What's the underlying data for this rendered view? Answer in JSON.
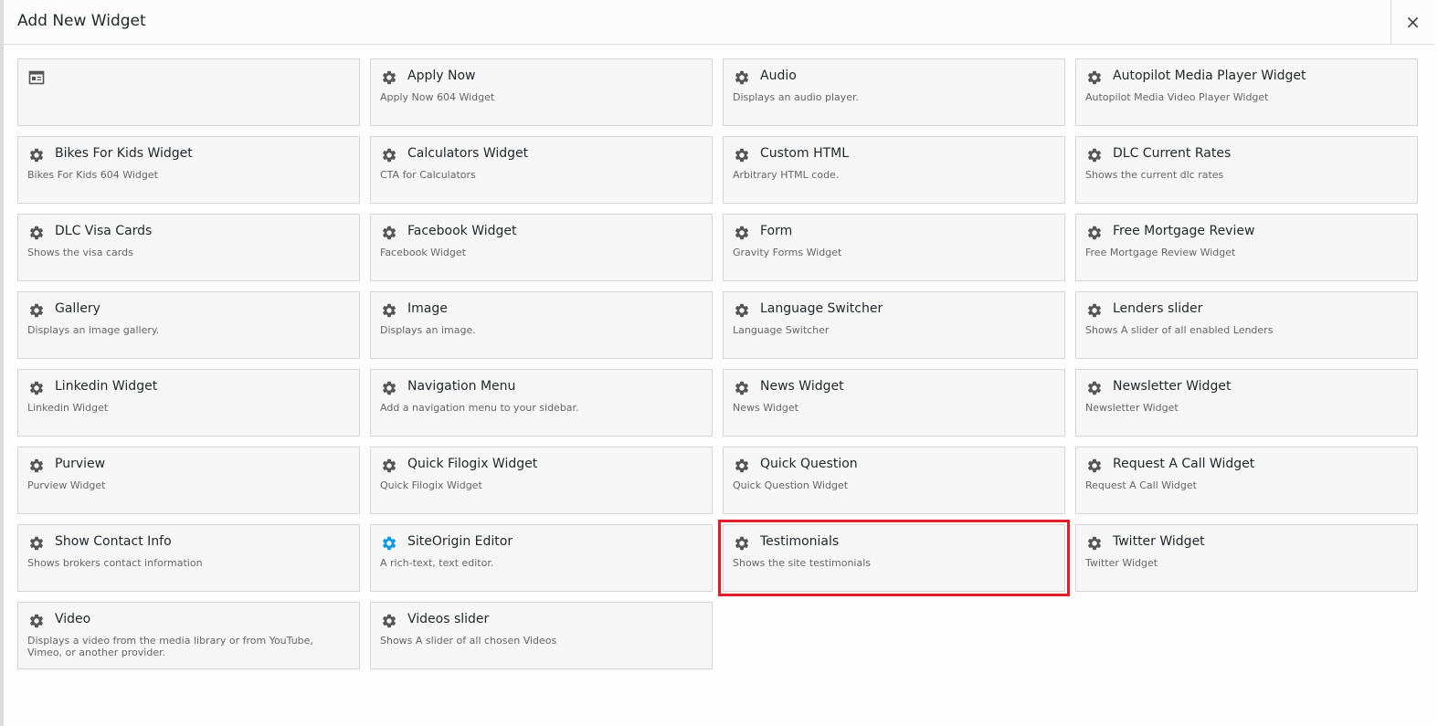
{
  "dialog": {
    "title": "Add New Widget",
    "close_label": "×"
  },
  "colors": {
    "icon_default": "#555555",
    "icon_active": "#0a9be8",
    "highlight_outline": "#e01d2b"
  },
  "widgets": [
    {
      "title": "",
      "desc": "",
      "icon": "siteorigin-widget-icon"
    },
    {
      "title": "Apply Now",
      "desc": "Apply Now 604 Widget",
      "icon": "gear-icon"
    },
    {
      "title": "Audio",
      "desc": "Displays an audio player.",
      "icon": "gear-icon"
    },
    {
      "title": "Autopilot Media Player Widget",
      "desc": "Autopilot Media Video Player Widget",
      "icon": "gear-icon"
    },
    {
      "title": "Bikes For Kids Widget",
      "desc": "Bikes For Kids 604 Widget",
      "icon": "gear-icon"
    },
    {
      "title": "Calculators Widget",
      "desc": "CTA for Calculators",
      "icon": "gear-icon"
    },
    {
      "title": "Custom HTML",
      "desc": "Arbitrary HTML code.",
      "icon": "gear-icon"
    },
    {
      "title": "DLC Current Rates",
      "desc": "Shows the current dlc rates",
      "icon": "gear-icon"
    },
    {
      "title": "DLC Visa Cards",
      "desc": "Shows the visa cards",
      "icon": "gear-icon"
    },
    {
      "title": "Facebook Widget",
      "desc": "Facebook Widget",
      "icon": "gear-icon"
    },
    {
      "title": "Form",
      "desc": "Gravity Forms Widget",
      "icon": "gear-icon"
    },
    {
      "title": "Free Mortgage Review",
      "desc": "Free Mortgage Review Widget",
      "icon": "gear-icon"
    },
    {
      "title": "Gallery",
      "desc": "Displays an image gallery.",
      "icon": "gear-icon"
    },
    {
      "title": "Image",
      "desc": "Displays an image.",
      "icon": "gear-icon"
    },
    {
      "title": "Language Switcher",
      "desc": "Language Switcher",
      "icon": "gear-icon"
    },
    {
      "title": "Lenders slider",
      "desc": "Shows A slider of all enabled Lenders",
      "icon": "gear-icon"
    },
    {
      "title": "Linkedin Widget",
      "desc": "Linkedin Widget",
      "icon": "gear-icon"
    },
    {
      "title": "Navigation Menu",
      "desc": "Add a navigation menu to your sidebar.",
      "icon": "gear-icon"
    },
    {
      "title": "News Widget",
      "desc": "News Widget",
      "icon": "gear-icon"
    },
    {
      "title": "Newsletter Widget",
      "desc": "Newsletter Widget",
      "icon": "gear-icon"
    },
    {
      "title": "Purview",
      "desc": "Purview Widget",
      "icon": "gear-icon"
    },
    {
      "title": "Quick Filogix Widget",
      "desc": "Quick Filogix Widget",
      "icon": "gear-icon"
    },
    {
      "title": "Quick Question",
      "desc": "Quick Question Widget",
      "icon": "gear-icon"
    },
    {
      "title": "Request A Call Widget",
      "desc": "Request A Call Widget",
      "icon": "gear-icon"
    },
    {
      "title": "Show Contact Info",
      "desc": "Shows brokers contact information",
      "icon": "gear-icon"
    },
    {
      "title": "SiteOrigin Editor",
      "desc": "A rich-text, text editor.",
      "icon": "gear-icon",
      "active": true
    },
    {
      "title": "Testimonials",
      "desc": "Shows the site testimonials",
      "icon": "gear-icon",
      "highlighted": true
    },
    {
      "title": "Twitter Widget",
      "desc": "Twitter Widget",
      "icon": "gear-icon"
    },
    {
      "title": "Video",
      "desc": "Displays a video from the media library or from YouTube, Vimeo, or another provider.",
      "icon": "gear-icon"
    },
    {
      "title": "Videos slider",
      "desc": "Shows A slider of all chosen Videos",
      "icon": "gear-icon"
    }
  ]
}
